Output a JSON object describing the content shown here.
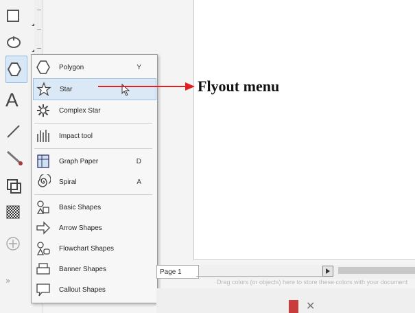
{
  "annotation": {
    "label": "Flyout menu",
    "color": "#e02020"
  },
  "flyout": {
    "items": [
      {
        "label": "Polygon",
        "shortcut": "Y",
        "icon": "polygon-icon"
      },
      {
        "label": "Star",
        "shortcut": "",
        "icon": "star-icon",
        "highlighted": true
      },
      {
        "label": "Complex Star",
        "shortcut": "",
        "icon": "complex-star-icon"
      },
      {
        "label": "Impact tool",
        "shortcut": "",
        "icon": "impact-tool-icon"
      },
      {
        "label": "Graph Paper",
        "shortcut": "D",
        "icon": "graph-paper-icon"
      },
      {
        "label": "Spiral",
        "shortcut": "A",
        "icon": "spiral-icon"
      },
      {
        "label": "Basic Shapes",
        "shortcut": "",
        "icon": "basic-shapes-icon"
      },
      {
        "label": "Arrow Shapes",
        "shortcut": "",
        "icon": "arrow-shapes-icon"
      },
      {
        "label": "Flowchart Shapes",
        "shortcut": "",
        "icon": "flowchart-shapes-icon"
      },
      {
        "label": "Banner Shapes",
        "shortcut": "",
        "icon": "banner-shapes-icon"
      },
      {
        "label": "Callout Shapes",
        "shortcut": "",
        "icon": "callout-shapes-icon"
      }
    ]
  },
  "toolbox": {
    "tools": [
      {
        "name": "rectangle-tool",
        "icon": "rectangle-icon"
      },
      {
        "name": "ellipse-tool",
        "icon": "ellipse-icon"
      },
      {
        "name": "polygon-tool",
        "icon": "polygon-icon",
        "active": true
      },
      {
        "name": "text-tool",
        "icon": "text-icon",
        "glyph": "A"
      },
      {
        "name": "line-tool",
        "icon": "line-icon"
      },
      {
        "name": "connector-tool",
        "icon": "connector-icon"
      },
      {
        "name": "shadow-tool",
        "icon": "shadow-icon"
      },
      {
        "name": "fill-tool",
        "icon": "checker-fill-icon"
      },
      {
        "name": "add-tool",
        "icon": "plus-circle-icon"
      }
    ]
  },
  "document": {
    "page_tab": "Page 1",
    "hint": "Drag colors (or objects) here to store these colors with your document"
  },
  "overflow": {
    "label": "»"
  }
}
